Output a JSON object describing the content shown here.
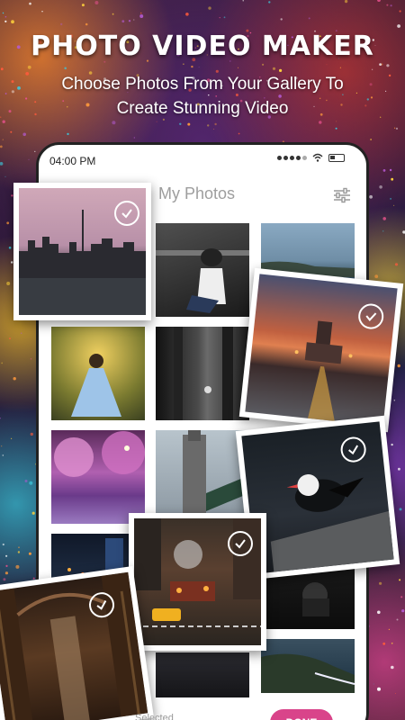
{
  "hero": {
    "title": "PHOTO VIDEO MAKER",
    "subtitle_line1": "Choose Photos From Your Gallery To",
    "subtitle_line2": "Create Stunning Video"
  },
  "status_bar": {
    "time": "04:00 PM",
    "icons": [
      "signal-dots-icon",
      "wifi-icon",
      "battery-icon"
    ]
  },
  "app_bar": {
    "title": "My Photos",
    "icon": "filter-sliders-icon"
  },
  "grid_photos": [
    {
      "subject": "woman-sitting-on-railing",
      "selected": false
    },
    {
      "subject": "sea-coastline",
      "selected": false
    },
    {
      "subject": "woman-in-blue-dress",
      "selected": false
    },
    {
      "subject": "dark-alley-street",
      "selected": false
    },
    {
      "subject": "pink-blossom-trees",
      "selected": false
    },
    {
      "subject": "tower-bridge",
      "selected": false
    },
    {
      "subject": "night-city-lights",
      "selected": false
    },
    {
      "subject": "person-with-camera",
      "selected": false
    },
    {
      "subject": "rocky-coast-aerial",
      "selected": false
    },
    {
      "subject": "dark-building-interior",
      "selected": false
    }
  ],
  "selected_photos": [
    {
      "subject": "city-skyline-dusk",
      "selected": true
    },
    {
      "subject": "sunset-road-city",
      "selected": true
    },
    {
      "subject": "seabird-on-rock",
      "selected": true
    },
    {
      "subject": "yellow-taxi-street",
      "selected": true
    },
    {
      "subject": "library-hall",
      "selected": true
    }
  ],
  "footer": {
    "selected_text": "Selected",
    "done_label": "DONE"
  },
  "colors": {
    "accent": "#d9448a",
    "check": "#ffffff"
  }
}
